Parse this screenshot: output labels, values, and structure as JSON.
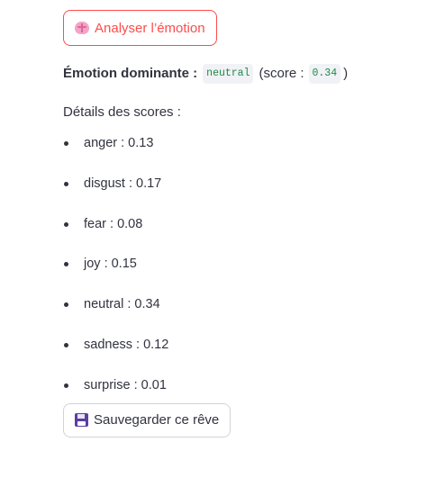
{
  "analyse_button": {
    "label": "Analyser l’émotion",
    "icon": "brain-icon"
  },
  "dominant": {
    "label": "Émotion dominante :",
    "value": "neutral",
    "score_prefix": "(score :",
    "score": "0.34",
    "score_suffix": ")"
  },
  "details_title": "Détails des scores :",
  "scores": [
    {
      "label": "anger : 0.13"
    },
    {
      "label": "disgust : 0.17"
    },
    {
      "label": "fear : 0.08"
    },
    {
      "label": "joy : 0.15"
    },
    {
      "label": "neutral : 0.34"
    },
    {
      "label": "sadness : 0.12"
    },
    {
      "label": "surprise : 0.01"
    }
  ],
  "save_button": {
    "label": "Sauvegarder ce rêve",
    "icon": "floppy-disk-icon"
  },
  "colors": {
    "accent": "#ff4b4b",
    "code_green": "#1e8a43",
    "text": "#31333f"
  }
}
